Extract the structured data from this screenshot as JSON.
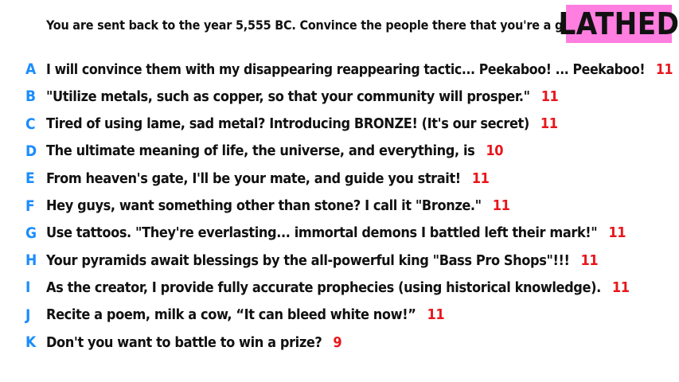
{
  "prompt": "You are sent back to the year 5,555 BC. Convince the people there that you're a god.",
  "badge": "LATHED",
  "colors": {
    "letter": "#1a8cff",
    "score": "#e8161b",
    "badge_bg": "#ff7ee0"
  },
  "answers": [
    {
      "letter": "A",
      "text": "I will convince them with my disappearing reappearing tactic... Peekaboo! ... Peekaboo!",
      "score": "11"
    },
    {
      "letter": "B",
      "text": "\"Utilize metals, such as copper, so that your community will prosper.\"",
      "score": "11"
    },
    {
      "letter": "C",
      "text": "Tired of using lame, sad metal? Introducing BRONZE! (It's our secret)",
      "score": "11"
    },
    {
      "letter": "D",
      "text": "The ultimate meaning of life, the universe, and everything, is",
      "score": "10"
    },
    {
      "letter": "E",
      "text": "From heaven's gate, I'll be your mate, and guide you strait!",
      "score": "11"
    },
    {
      "letter": "F",
      "text": "Hey guys, want something other than stone? I call it \"Bronze.\"",
      "score": "11"
    },
    {
      "letter": "G",
      "text": "Use tattoos. \"They're everlasting... immortal demons I battled left their mark!\"",
      "score": "11"
    },
    {
      "letter": "H",
      "text": "Your pyramids await blessings by the all-powerful king \"Bass Pro Shops\"!!!",
      "score": "11"
    },
    {
      "letter": "I",
      "text": "As the creator, I provide fully accurate prophecies (using historical knowledge).",
      "score": "11"
    },
    {
      "letter": "J",
      "text": "Recite a poem, milk a cow, “It can bleed white now!”",
      "score": "11"
    },
    {
      "letter": "K",
      "text": "Don't you want to battle to win a prize?",
      "score": "9"
    }
  ]
}
